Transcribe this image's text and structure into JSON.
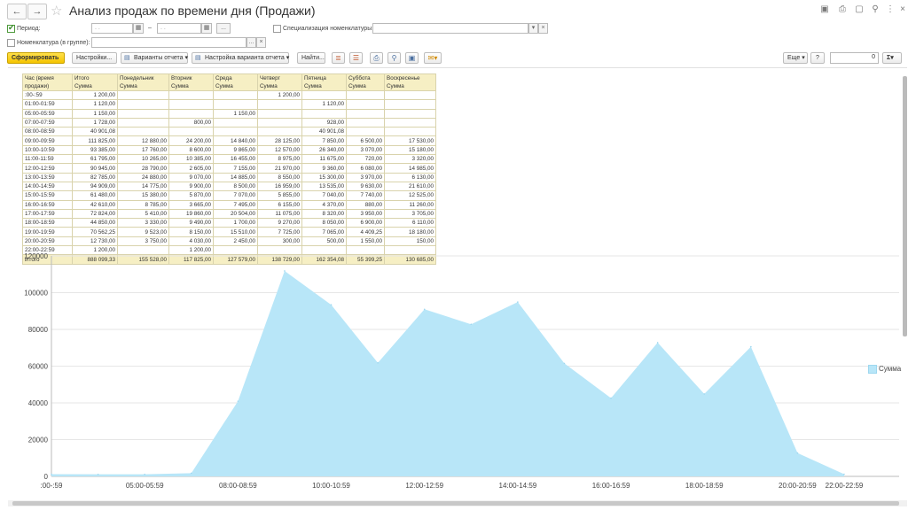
{
  "window": {
    "title": "Анализ продаж по времени дня (Продажи)",
    "back_icon": "arrow-left-icon",
    "forward_icon": "arrow-right-icon",
    "favorite_icon": "star-icon"
  },
  "filters": {
    "period_label": "Период:",
    "period_checked": true,
    "period_from_placeholder": ". .",
    "period_to_placeholder": ". .",
    "dash": "–",
    "dots_label": "...",
    "spec_label": "Специализация номенклатуры:",
    "nomen_label": "Номенклатура (в группе):",
    "clear_label": "×",
    "dropdown_label": "▾"
  },
  "toolbar": {
    "generate": "Сформировать",
    "settings": "Настройки...",
    "report_variants": "Варианты отчета",
    "variant_settings": "Настройка варианта отчета",
    "find": "Найти...",
    "more": "Еще",
    "help": "?",
    "counter": "0",
    "sum": "Σ"
  },
  "table": {
    "headers_top": [
      "Час (время",
      "Итого",
      "Понедельник",
      "Вторник",
      "Среда",
      "Четверг",
      "Пятница",
      "Суббота",
      "Воскресенье"
    ],
    "headers_bottom": [
      "продажи)",
      "Сумма",
      "Сумма",
      "Сумма",
      "Сумма",
      "Сумма",
      "Сумма",
      "Сумма",
      "Сумма"
    ],
    "rows": [
      [
        ":00-:59",
        "1 200,00",
        "",
        "",
        "",
        "1 200,00",
        "",
        "",
        ""
      ],
      [
        "01:00-01:59",
        "1 120,00",
        "",
        "",
        "",
        "",
        "1 120,00",
        "",
        ""
      ],
      [
        "05:00-05:59",
        "1 150,00",
        "",
        "",
        "1 150,00",
        "",
        "",
        "",
        ""
      ],
      [
        "07:00-07:59",
        "1 728,00",
        "",
        "800,00",
        "",
        "",
        "928,00",
        "",
        ""
      ],
      [
        "08:00-08:59",
        "40 901,08",
        "",
        "",
        "",
        "",
        "40 901,08",
        "",
        ""
      ],
      [
        "09:00-09:59",
        "111 825,00",
        "12 880,00",
        "24 200,00",
        "14 840,00",
        "28 125,00",
        "7 850,00",
        "6 500,00",
        "17 530,00"
      ],
      [
        "10:00-10:59",
        "93 385,00",
        "17 760,00",
        "8 600,00",
        "9 865,00",
        "12 570,00",
        "26 340,00",
        "3 070,00",
        "15 180,00"
      ],
      [
        "11:00-11:59",
        "61 795,00",
        "10 265,00",
        "10 385,00",
        "16 455,00",
        "8 975,00",
        "11 675,00",
        "720,00",
        "3 320,00"
      ],
      [
        "12:00-12:59",
        "90 945,00",
        "28 790,00",
        "2 605,00",
        "7 155,00",
        "21 970,00",
        "9 360,00",
        "6 080,00",
        "14 985,00"
      ],
      [
        "13:00-13:59",
        "82 785,00",
        "24 880,00",
        "9 070,00",
        "14 885,00",
        "8 550,00",
        "15 300,00",
        "3 970,00",
        "6 130,00"
      ],
      [
        "14:00-14:59",
        "94 909,00",
        "14 775,00",
        "9 900,00",
        "8 500,00",
        "16 959,00",
        "13 535,00",
        "9 630,00",
        "21 610,00"
      ],
      [
        "15:00-15:59",
        "61 480,00",
        "15 380,00",
        "5 870,00",
        "7 070,00",
        "5 855,00",
        "7 040,00",
        "7 740,00",
        "12 525,00"
      ],
      [
        "16:00-16:59",
        "42 610,00",
        "8 785,00",
        "3 665,00",
        "7 495,00",
        "6 155,00",
        "4 370,00",
        "880,00",
        "11 260,00"
      ],
      [
        "17:00-17:59",
        "72 824,00",
        "5 410,00",
        "19 860,00",
        "20 504,00",
        "11 075,00",
        "8 320,00",
        "3 950,00",
        "3 705,00"
      ],
      [
        "18:00-18:59",
        "44 850,00",
        "3 330,00",
        "9 490,00",
        "1 700,00",
        "9 270,00",
        "8 050,00",
        "6 900,00",
        "6 110,00"
      ],
      [
        "19:00-19:59",
        "70 562,25",
        "9 523,00",
        "8 150,00",
        "15 510,00",
        "7 725,00",
        "7 065,00",
        "4 409,25",
        "18 180,00"
      ],
      [
        "20:00-20:59",
        "12 730,00",
        "3 750,00",
        "4 030,00",
        "2 450,00",
        "300,00",
        "500,00",
        "1 550,00",
        "150,00"
      ],
      [
        "22:00-22:59",
        "1 200,00",
        "",
        "1 200,00",
        "",
        "",
        "",
        "",
        ""
      ]
    ],
    "total": [
      "Итого",
      "888 099,33",
      "155 528,00",
      "117 825,00",
      "127 579,00",
      "138 729,00",
      "162 354,08",
      "55 399,25",
      "130 685,00"
    ]
  },
  "chart_data": {
    "type": "area",
    "categories": [
      ":00-:59",
      "01:00-01:59",
      "05:00-05:59",
      "07:00-07:59",
      "08:00-08:59",
      "09:00-09:59",
      "10:00-10:59",
      "11:00-11:59",
      "12:00-12:59",
      "13:00-13:59",
      "14:00-14:59",
      "15:00-15:59",
      "16:00-16:59",
      "17:00-17:59",
      "18:00-18:59",
      "19:00-19:59",
      "20:00-20:59",
      "22:00-22:59"
    ],
    "series": [
      {
        "name": "Сумма",
        "values": [
          1200,
          1120,
          1150,
          1728,
          40901.08,
          111825,
          93385,
          61795,
          90945,
          82785,
          94909,
          61480,
          42610,
          72824,
          44850,
          70562.25,
          12730,
          1200
        ]
      }
    ],
    "yticks": [
      "0",
      "20000",
      "40000",
      "60000",
      "80000",
      "100000",
      "120000"
    ],
    "ylim": [
      0,
      120000
    ],
    "grid": true,
    "legend": "right",
    "color": "#b8e6f8"
  }
}
